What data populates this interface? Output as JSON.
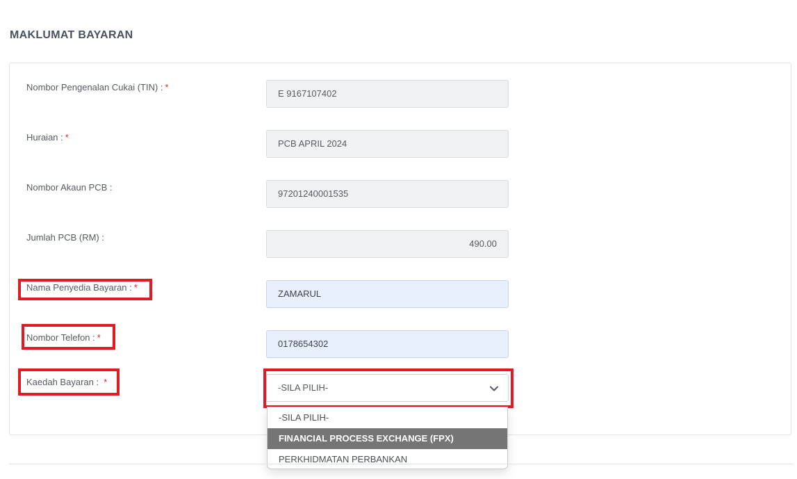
{
  "section": {
    "title": "MAKLUMAT BAYARAN"
  },
  "fields": {
    "tin": {
      "label": "Nombor Pengenalan Cukai (TIN) :",
      "value": "E 9167107402",
      "required_mark": "*"
    },
    "huraian": {
      "label": "Huraian :",
      "value": "PCB APRIL 2024",
      "required_mark": "*"
    },
    "akaun_pcb": {
      "label": "Nombor Akaun PCB :",
      "value": "97201240001535"
    },
    "jumlah_pcb": {
      "label": "Jumlah PCB (RM) :",
      "value": "490.00"
    },
    "nama_penyedia": {
      "label": "Nama Penyedia Bayaran :",
      "value": "ZAMARUL",
      "required_mark": "*"
    },
    "telefon": {
      "label": "Nombor Telefon :",
      "value": "0178654302",
      "required_mark": "*"
    },
    "kaedah": {
      "label": "Kaedah Bayaran :",
      "selected": "-SILA PILIH-",
      "required_mark": "*"
    }
  },
  "dropdown": {
    "options": [
      "-SILA PILIH-",
      "FINANCIAL PROCESS EXCHANGE (FPX)",
      "PERKHIDMATAN PERBANKAN"
    ],
    "highlighted_index": 1
  },
  "colors": {
    "highlight_box": "#e01b24",
    "required_asterisk": "#e02424",
    "readonly_field_bg": "#f1f2f4",
    "editable_field_bg": "#e8effd",
    "active_option_bg": "#757575"
  },
  "icons": {
    "select_arrow": "chevron-down-icon"
  }
}
